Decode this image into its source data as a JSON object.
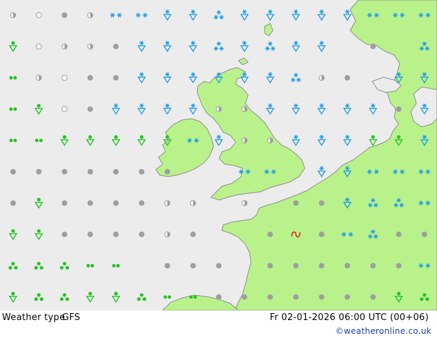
{
  "footer": {
    "label": "Weather type",
    "model": "GFS",
    "datetime": "Fr 02-01-2026 06:00 UTC (00+06)",
    "credit": "©weatheronline.co.uk"
  },
  "colors": {
    "sea": "#ececec",
    "land": "#b9f28a",
    "coast": "#8c8c8c",
    "snow": "#1a9ae6",
    "shower": "#22c422",
    "cloud": "#9e9e9e",
    "thunder": "#e02020"
  },
  "symbol_legend": {
    "snow": "snow-icon",
    "snow_shower": "snow-shower-icon",
    "rain_shower": "rain-shower-icon",
    "drizzle": "drizzle-icon",
    "overcast": "overcast-icon",
    "partly_cloudy": "partly-cloudy-icon",
    "clear": "clear-icon",
    "thunder": "thunder-icon",
    "hail": "hail-icon"
  },
  "grid_symbols": [
    [
      "half",
      "clear",
      "overcast",
      "half",
      "snow",
      "snow",
      "snowsh",
      "snowsh",
      "snowfl",
      "snowsh",
      "snowsh",
      "snowsh",
      "snowsh",
      "snowsh",
      "snow",
      "snow",
      "snow"
    ],
    [
      "rainsh",
      "clear",
      "half",
      "half",
      "overcast",
      "snowsh",
      "snowsh",
      "snowsh",
      "snowfl",
      "snowsh",
      "snowfl",
      "snowsh",
      "snowsh",
      "none",
      "overcast",
      "none",
      "snowfl"
    ],
    [
      "drizzle",
      "half",
      "clear",
      "overcast",
      "overcast",
      "snowsh",
      "snowsh",
      "snowsh",
      "snowsh",
      "snowsh",
      "snowsh",
      "snowfl",
      "half",
      "overcast",
      "none",
      "snowsh",
      "snowsh"
    ],
    [
      "drizzle",
      "rainsh",
      "clear",
      "overcast",
      "snowsh",
      "snowsh",
      "snowsh",
      "snowsh",
      "half",
      "half",
      "snowsh",
      "snowsh",
      "snowsh",
      "snowsh",
      "snowsh",
      "overcast",
      "snowsh"
    ],
    [
      "drizzle",
      "drizzle",
      "rainsh",
      "rainsh",
      "rainsh",
      "rainsh",
      "rainsh",
      "snow",
      "snowsh",
      "half",
      "half",
      "snowsh",
      "snowsh",
      "snowsh",
      "rainsh",
      "rainsh",
      "snowsh"
    ],
    [
      "overcast",
      "overcast",
      "overcast",
      "overcast",
      "overcast",
      "overcast",
      "overcast",
      "none",
      "none",
      "snow",
      "snow",
      "none",
      "snowsh",
      "snowsh",
      "snow",
      "snow",
      "snow"
    ],
    [
      "overcast",
      "rainsh",
      "overcast",
      "overcast",
      "overcast",
      "overcast",
      "half",
      "half",
      "none",
      "half",
      "none",
      "overcast",
      "overcast",
      "snowsh",
      "snowfl",
      "snowfl",
      "snow"
    ],
    [
      "rainsh",
      "rainsh",
      "overcast",
      "overcast",
      "overcast",
      "overcast",
      "half",
      "overcast",
      "none",
      "none",
      "overcast",
      "thunder",
      "overcast",
      "snow",
      "snowfl",
      "overcast",
      "overcast"
    ],
    [
      "shower",
      "shower",
      "shower",
      "drizzle",
      "drizzle",
      "none",
      "overcast",
      "overcast",
      "overcast",
      "none",
      "overcast",
      "overcast",
      "overcast",
      "overcast",
      "overcast",
      "overcast",
      "snow"
    ],
    [
      "rainsh",
      "shower",
      "shower",
      "rainsh",
      "rainsh",
      "shower",
      "drizzle",
      "drizzle",
      "overcast",
      "overcast",
      "overcast",
      "overcast",
      "overcast",
      "overcast",
      "overcast",
      "rainsh",
      "shower"
    ]
  ]
}
